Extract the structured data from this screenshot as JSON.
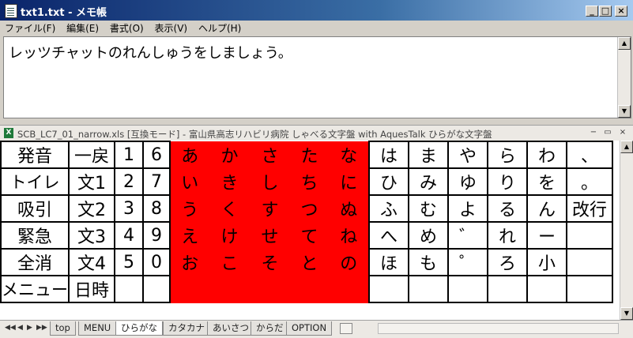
{
  "notepad": {
    "title": "txt1.txt - メモ帳",
    "menu": [
      "ファイル(F)",
      "編集(E)",
      "書式(O)",
      "表示(V)",
      "ヘルプ(H)"
    ],
    "content": "レッツチャットのれんしゅうをしましょう。",
    "window_buttons": {
      "minimize": "_",
      "maximize": "□",
      "close": "×"
    }
  },
  "excel": {
    "title": "SCB_LC7_01_narrow.xls  [互換モード] - 富山県高志リハビリ病院  しゃべる文字盤 with AquesTalk  ひらがな文字盤",
    "icon_letter": "X",
    "window_buttons": {
      "minimize": "−",
      "restore": "▭",
      "close": "×"
    },
    "grid": [
      [
        "発音",
        "一戻",
        "1",
        "6",
        "あ",
        "か",
        "さ",
        "た",
        "な",
        "は",
        "ま",
        "や",
        "ら",
        "わ",
        "、"
      ],
      [
        "トイレ",
        "文1",
        "2",
        "7",
        "い",
        "き",
        "し",
        "ち",
        "に",
        "ひ",
        "み",
        "ゆ",
        "り",
        "を",
        "。"
      ],
      [
        "吸引",
        "文2",
        "3",
        "8",
        "う",
        "く",
        "す",
        "つ",
        "ぬ",
        "ふ",
        "む",
        "よ",
        "る",
        "ん",
        "改行"
      ],
      [
        "緊急",
        "文3",
        "4",
        "9",
        "え",
        "け",
        "せ",
        "て",
        "ね",
        "へ",
        "め",
        "゛",
        "れ",
        "ー",
        ""
      ],
      [
        "全消",
        "文4",
        "5",
        "0",
        "お",
        "こ",
        "そ",
        "と",
        "の",
        "ほ",
        "も",
        "゜",
        "ろ",
        "小",
        ""
      ],
      [
        "メニュー",
        "日時",
        "",
        "",
        "",
        "",
        "",
        "",
        "",
        "",
        "",
        "",
        "",
        "",
        ""
      ]
    ],
    "red_color": "#ff0000",
    "tabs": [
      "top",
      "MENU",
      "ひらがな",
      "カタカナ",
      "あいさつ",
      "からだ",
      "OPTION"
    ],
    "active_tab": "ひらがな",
    "tab_nav": [
      "◀◀",
      "◀",
      "▶",
      "▶▶"
    ]
  }
}
